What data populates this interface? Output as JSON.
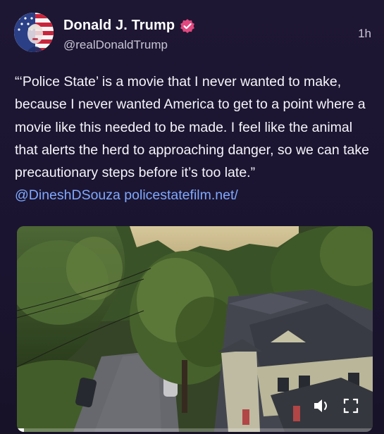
{
  "author": {
    "display_name": "Donald J. Trump",
    "handle": "@realDonaldTrump",
    "verified": true,
    "avatar_icon": "american-flag-portrait-icon"
  },
  "post": {
    "timestamp": "1h",
    "text": "“‘Police State’ is a movie that I never wanted to make, because I never wanted America to get to a point where a movie like this needed to be made. I feel like the animal that alerts the herd to approaching danger, so we can take precautionary steps before it’s too late.”",
    "mention": "@DineshDSouza",
    "link": "policestatefilm.net/"
  },
  "media": {
    "type": "video",
    "sound_icon": "speaker-icon",
    "fullscreen_icon": "fullscreen-icon",
    "progress": 0.02
  },
  "colors": {
    "background": "#1b1530",
    "link": "#7fa8ff",
    "verified_badge": "#e2487f"
  }
}
